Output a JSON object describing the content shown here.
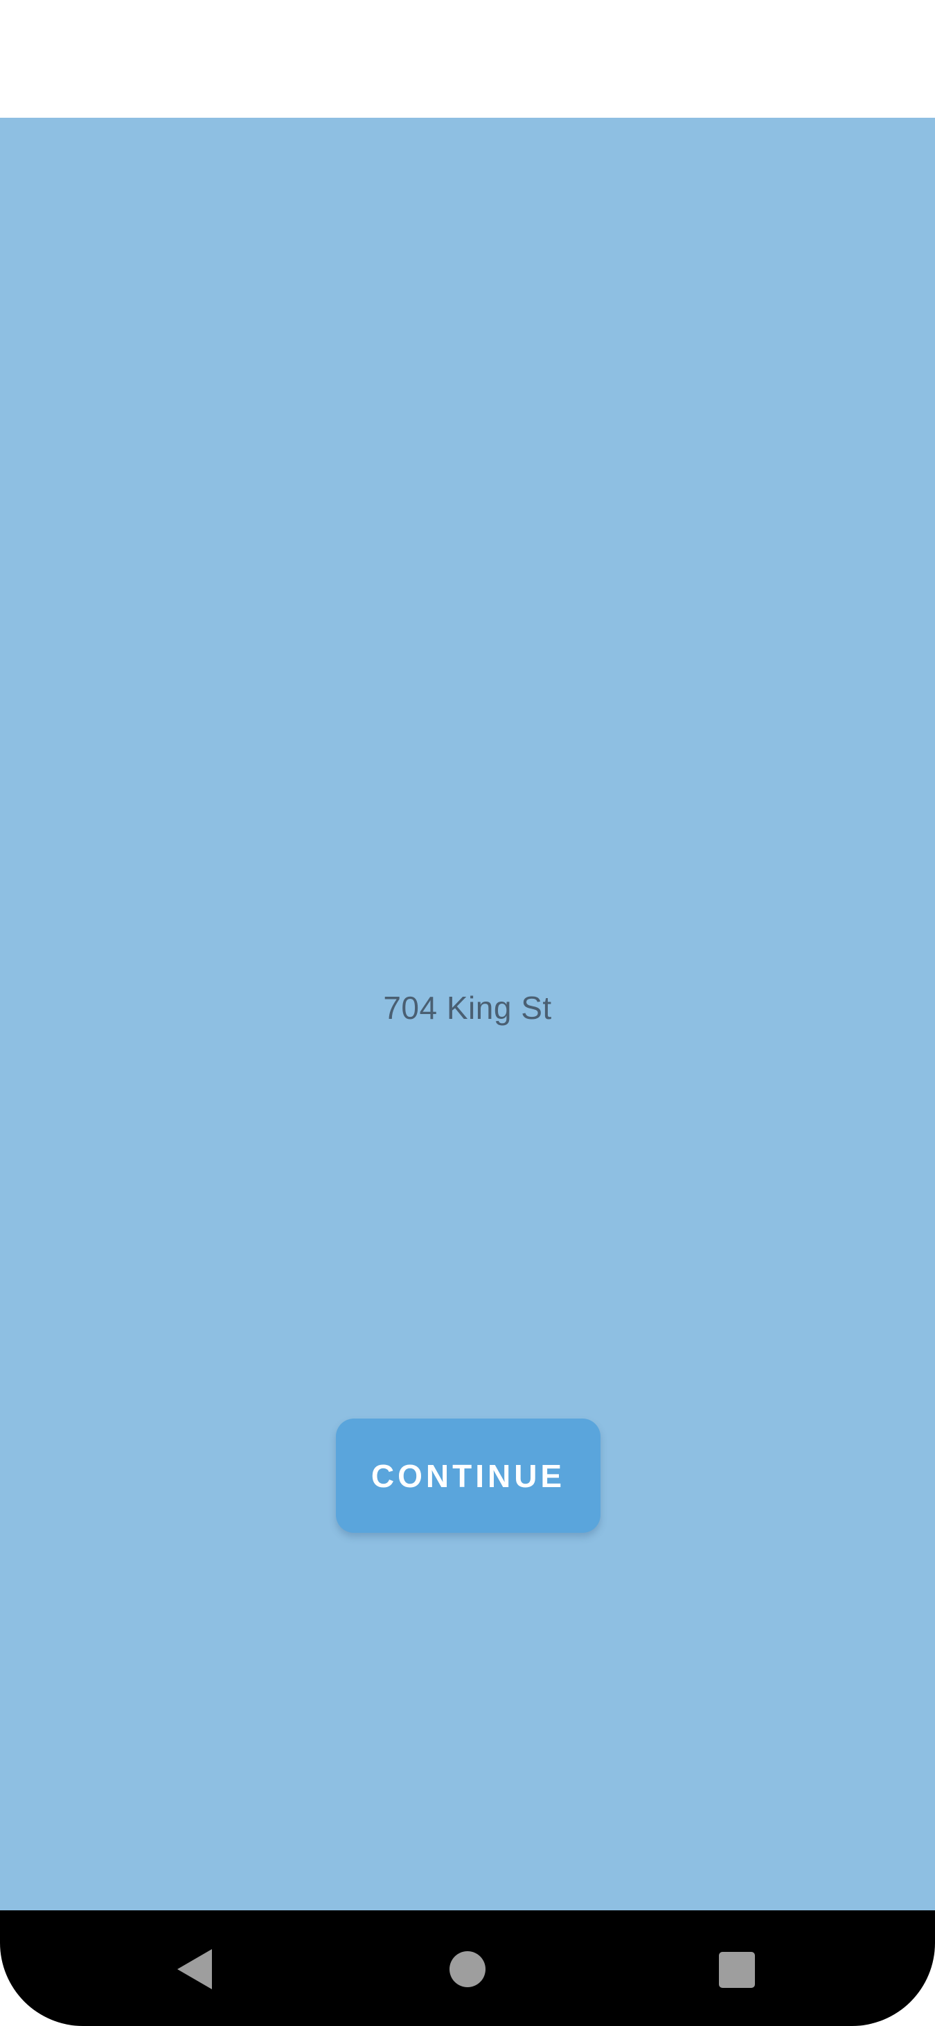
{
  "address": {
    "text": "704 King St"
  },
  "continue_button": {
    "label": "CONTINUE"
  },
  "navigation": {
    "back_icon": "back-triangle-icon",
    "home_icon": "home-circle-icon",
    "recents_icon": "recents-square-icon"
  },
  "colors": {
    "background": "#8ebfe2",
    "button": "#5aa5dc",
    "address_text": "#4a5f72",
    "nav_bar": "#000000",
    "nav_icons": "#9e9e9e"
  }
}
